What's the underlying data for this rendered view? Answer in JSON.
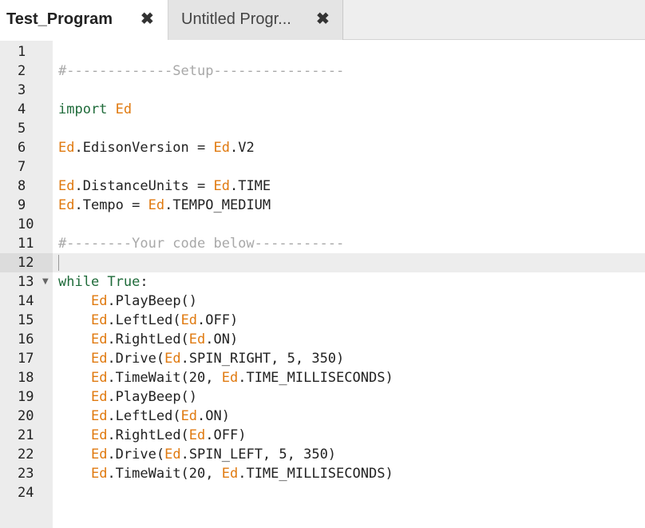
{
  "tabs": [
    {
      "label": "Test_Program",
      "active": true,
      "close_icon": "✖"
    },
    {
      "label": "Untitled Progr...",
      "active": false,
      "close_icon": "✖"
    }
  ],
  "editor": {
    "current_line": 12,
    "colors": {
      "comment": "#a8a8a8",
      "keyword": "#1f6b3a",
      "module": "#e07a10",
      "plain": "#222222"
    },
    "lines": [
      {
        "n": "1",
        "tokens": []
      },
      {
        "n": "2",
        "tokens": [
          {
            "c": "comment",
            "t": "#-------------Setup----------------"
          }
        ]
      },
      {
        "n": "3",
        "tokens": []
      },
      {
        "n": "4",
        "tokens": [
          {
            "c": "keyword",
            "t": "import "
          },
          {
            "c": "module",
            "t": "Ed"
          }
        ]
      },
      {
        "n": "5",
        "tokens": []
      },
      {
        "n": "6",
        "tokens": [
          {
            "c": "module",
            "t": "Ed"
          },
          {
            "c": "plain",
            "t": ".EdisonVersion = "
          },
          {
            "c": "module",
            "t": "Ed"
          },
          {
            "c": "plain",
            "t": ".V2"
          }
        ]
      },
      {
        "n": "7",
        "tokens": []
      },
      {
        "n": "8",
        "tokens": [
          {
            "c": "module",
            "t": "Ed"
          },
          {
            "c": "plain",
            "t": ".DistanceUnits = "
          },
          {
            "c": "module",
            "t": "Ed"
          },
          {
            "c": "plain",
            "t": ".TIME"
          }
        ]
      },
      {
        "n": "9",
        "tokens": [
          {
            "c": "module",
            "t": "Ed"
          },
          {
            "c": "plain",
            "t": ".Tempo = "
          },
          {
            "c": "module",
            "t": "Ed"
          },
          {
            "c": "plain",
            "t": ".TEMPO_MEDIUM"
          }
        ]
      },
      {
        "n": "10",
        "tokens": []
      },
      {
        "n": "11",
        "tokens": [
          {
            "c": "comment",
            "t": "#--------Your code below-----------"
          }
        ]
      },
      {
        "n": "12",
        "tokens": []
      },
      {
        "n": "13",
        "fold": true,
        "tokens": [
          {
            "c": "keyword",
            "t": "while True"
          },
          {
            "c": "plain",
            "t": ":"
          }
        ]
      },
      {
        "n": "14",
        "tokens": [
          {
            "c": "plain",
            "t": "    "
          },
          {
            "c": "module",
            "t": "Ed"
          },
          {
            "c": "plain",
            "t": ".PlayBeep()"
          }
        ]
      },
      {
        "n": "15",
        "tokens": [
          {
            "c": "plain",
            "t": "    "
          },
          {
            "c": "module",
            "t": "Ed"
          },
          {
            "c": "plain",
            "t": ".LeftLed("
          },
          {
            "c": "module",
            "t": "Ed"
          },
          {
            "c": "plain",
            "t": ".OFF)"
          }
        ]
      },
      {
        "n": "16",
        "tokens": [
          {
            "c": "plain",
            "t": "    "
          },
          {
            "c": "module",
            "t": "Ed"
          },
          {
            "c": "plain",
            "t": ".RightLed("
          },
          {
            "c": "module",
            "t": "Ed"
          },
          {
            "c": "plain",
            "t": ".ON)"
          }
        ]
      },
      {
        "n": "17",
        "tokens": [
          {
            "c": "plain",
            "t": "    "
          },
          {
            "c": "module",
            "t": "Ed"
          },
          {
            "c": "plain",
            "t": ".Drive("
          },
          {
            "c": "module",
            "t": "Ed"
          },
          {
            "c": "plain",
            "t": ".SPIN_RIGHT, 5, 350)"
          }
        ]
      },
      {
        "n": "18",
        "tokens": [
          {
            "c": "plain",
            "t": "    "
          },
          {
            "c": "module",
            "t": "Ed"
          },
          {
            "c": "plain",
            "t": ".TimeWait(20, "
          },
          {
            "c": "module",
            "t": "Ed"
          },
          {
            "c": "plain",
            "t": ".TIME_MILLISECONDS)"
          }
        ]
      },
      {
        "n": "19",
        "tokens": [
          {
            "c": "plain",
            "t": "    "
          },
          {
            "c": "module",
            "t": "Ed"
          },
          {
            "c": "plain",
            "t": ".PlayBeep()"
          }
        ]
      },
      {
        "n": "20",
        "tokens": [
          {
            "c": "plain",
            "t": "    "
          },
          {
            "c": "module",
            "t": "Ed"
          },
          {
            "c": "plain",
            "t": ".LeftLed("
          },
          {
            "c": "module",
            "t": "Ed"
          },
          {
            "c": "plain",
            "t": ".ON)"
          }
        ]
      },
      {
        "n": "21",
        "tokens": [
          {
            "c": "plain",
            "t": "    "
          },
          {
            "c": "module",
            "t": "Ed"
          },
          {
            "c": "plain",
            "t": ".RightLed("
          },
          {
            "c": "module",
            "t": "Ed"
          },
          {
            "c": "plain",
            "t": ".OFF)"
          }
        ]
      },
      {
        "n": "22",
        "tokens": [
          {
            "c": "plain",
            "t": "    "
          },
          {
            "c": "module",
            "t": "Ed"
          },
          {
            "c": "plain",
            "t": ".Drive("
          },
          {
            "c": "module",
            "t": "Ed"
          },
          {
            "c": "plain",
            "t": ".SPIN_LEFT, 5, 350)"
          }
        ]
      },
      {
        "n": "23",
        "tokens": [
          {
            "c": "plain",
            "t": "    "
          },
          {
            "c": "module",
            "t": "Ed"
          },
          {
            "c": "plain",
            "t": ".TimeWait(20, "
          },
          {
            "c": "module",
            "t": "Ed"
          },
          {
            "c": "plain",
            "t": ".TIME_MILLISECONDS)"
          }
        ]
      },
      {
        "n": "24",
        "tokens": []
      }
    ]
  }
}
